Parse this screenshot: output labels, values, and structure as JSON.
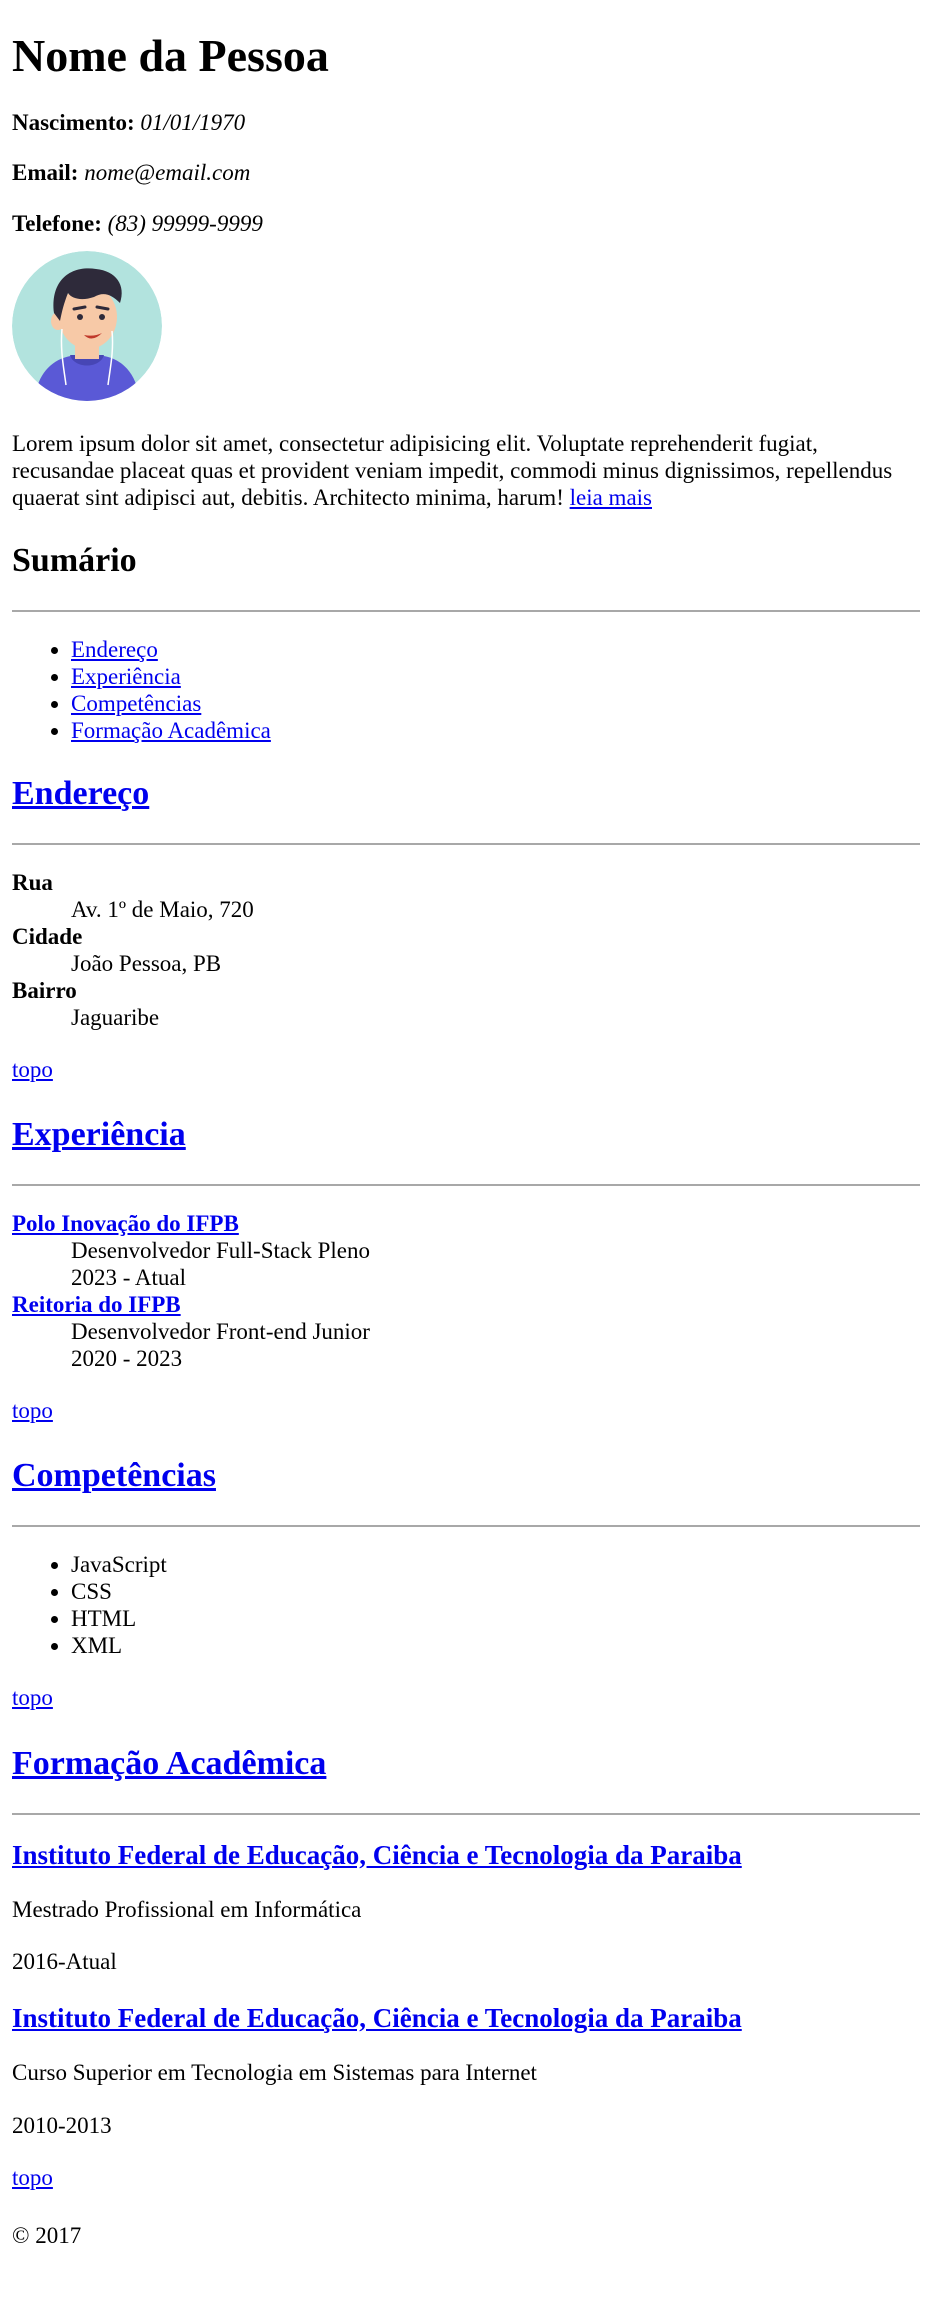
{
  "header": {
    "name": "Nome da Pessoa",
    "birth_label": "Nascimento:",
    "birth_value": "01/01/1970",
    "email_label": "Email:",
    "email_value": "nome@email.com",
    "phone_label": "Telefone:",
    "phone_value": "(83) 99999-9999"
  },
  "avatar": {
    "bg_color": "#b2e3de",
    "hair_color": "#2e2a3a",
    "skin_color": "#f7c9a7",
    "shirt_color": "#5a59d6"
  },
  "bio": {
    "text": "Lorem ipsum dolor sit amet, consectetur adipisicing elit. Voluptate reprehenderit fugiat, recusandae placeat quas et provident veniam impedit, commodi minus dignissimos, repellendus quaerat sint adipisci aut, debitis. Architecto minima, harum!",
    "read_more": "leia mais"
  },
  "summary": {
    "title": "Sumário",
    "items": [
      "Endereço",
      "Experiência",
      "Competências",
      "Formação Acadêmica"
    ]
  },
  "address": {
    "title": "Endereço",
    "street_label": "Rua",
    "street_value": "Av. 1º de Maio, 720",
    "city_label": "Cidade",
    "city_value": "João Pessoa, PB",
    "district_label": "Bairro",
    "district_value": "Jaguaribe"
  },
  "experience": {
    "title": "Experiência",
    "jobs": [
      {
        "company": "Polo Inovação do IFPB",
        "role": "Desenvolvedor Full-Stack Pleno",
        "period": "2023 - Atual"
      },
      {
        "company": "Reitoria do IFPB",
        "role": "Desenvolvedor Front-end Junior",
        "period": "2020 - 2023"
      }
    ]
  },
  "skills": {
    "title": "Competências",
    "items": [
      "JavaScript",
      "CSS",
      "HTML",
      "XML"
    ]
  },
  "education": {
    "title": "Formação Acadêmica",
    "entries": [
      {
        "institution": "Instituto Federal de Educação, Ciência e Tecnologia da Paraiba",
        "course": "Mestrado Profissional em Informática",
        "period": "2016-Atual"
      },
      {
        "institution": "Instituto Federal de Educação, Ciência e Tecnologia da Paraiba",
        "course": "Curso Superior em Tecnologia em Sistemas para Internet",
        "period": "2010-2013"
      }
    ]
  },
  "back_to_top": "topo",
  "footer": "© 2017",
  "colors": {
    "link": "#0000ee",
    "rule": "#a8a8a8"
  }
}
